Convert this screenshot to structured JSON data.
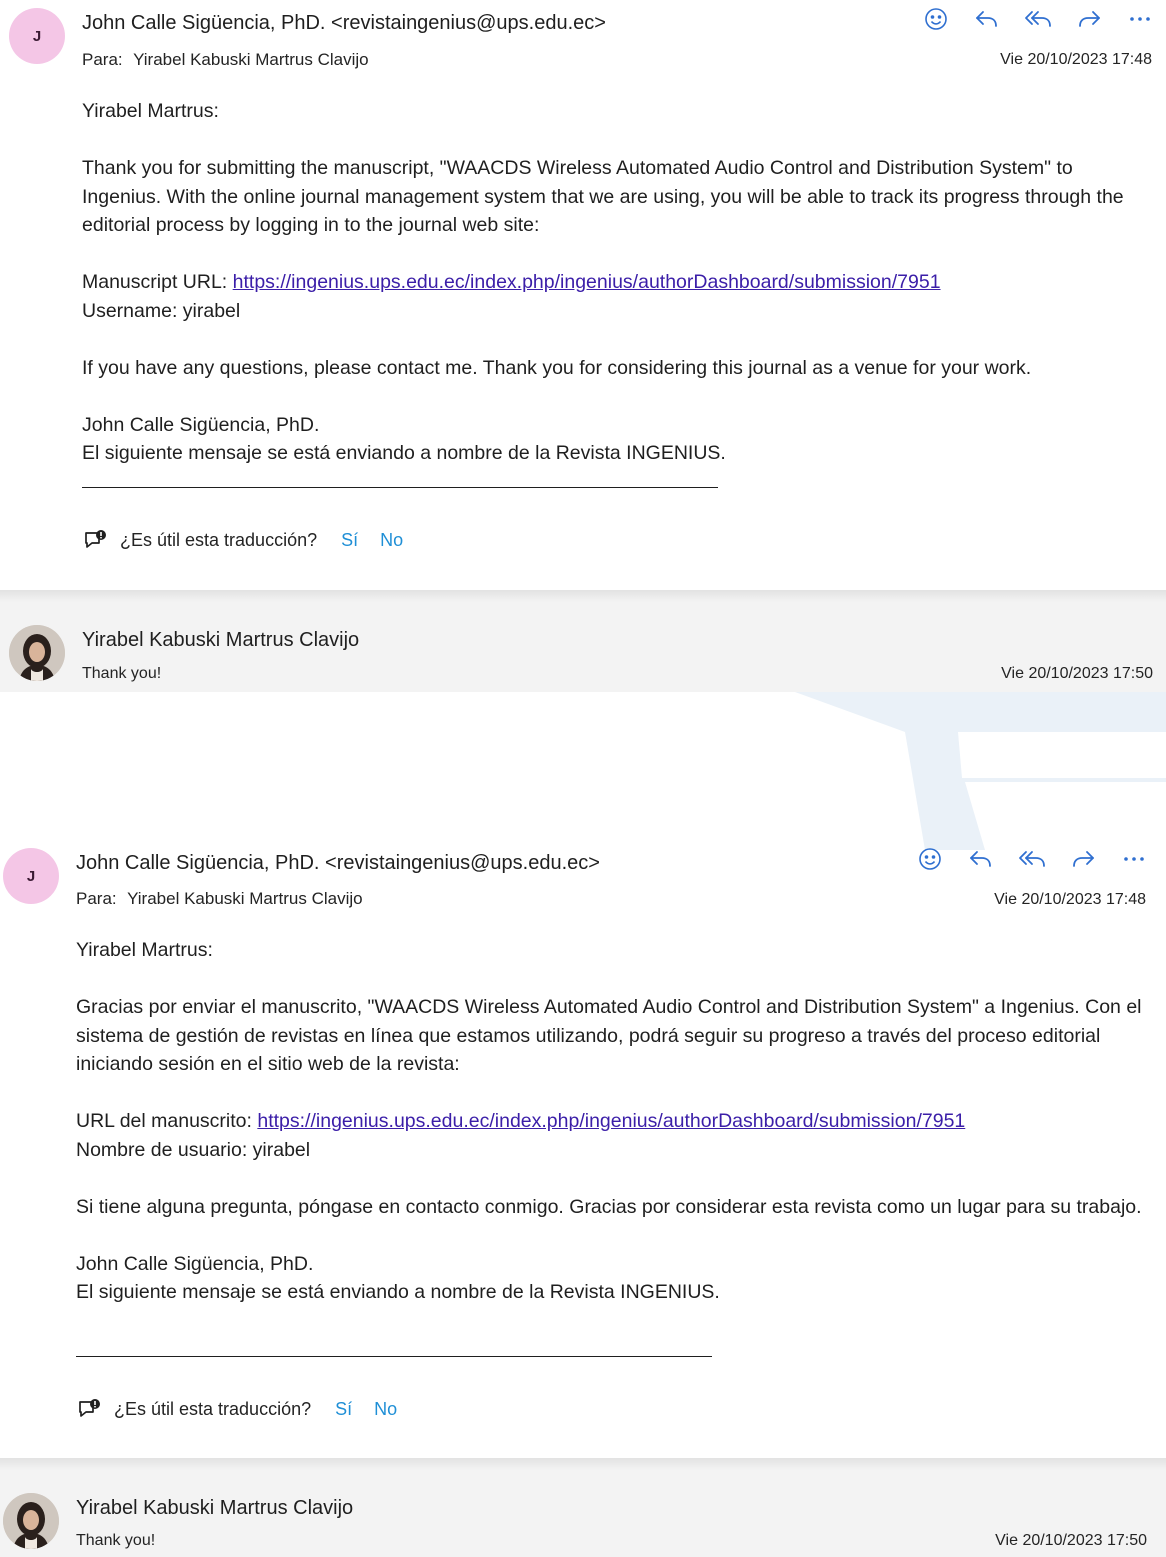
{
  "email1": {
    "avatar_letter": "J",
    "sender": "John Calle Sigüencia, PhD. <revistaingenius@ups.edu.ec>",
    "to_label": "Para:",
    "to": "Yirabel Kabuski Martrus Clavijo",
    "date": "Vie 20/10/2023 17:48",
    "actions": [
      "smiley-icon",
      "reply-icon",
      "reply-all-icon",
      "forward-icon",
      "more-icon"
    ],
    "greeting": "Yirabel Martrus:",
    "paragraph1": "Thank you for submitting the manuscript, \"WAACDS Wireless Automated Audio Control and Distribution System\" to Ingenius. With the online journal management system that we are using, you will be able to track its progress through the editorial process by logging in to the journal web site:",
    "url_label": "Manuscript URL:",
    "url": "https://ingenius.ups.edu.ec/index.php/ingenius/authorDashboard/submission/7951",
    "username_line": "Username: yirabel",
    "paragraph2": "If you have any questions, please contact me. Thank you for considering this journal as a venue for your work.",
    "signature_name": "John Calle Sigüencia, PhD.",
    "signature_note": "El siguiente mensaje se está enviando a nombre de la Revista INGENIUS.",
    "feedback_question": "¿Es útil esta traducción?",
    "feedback_yes": "Sí",
    "feedback_no": "No"
  },
  "reply1": {
    "name": "Yirabel Kabuski Martrus Clavijo",
    "preview": "Thank you!",
    "date": "Vie 20/10/2023 17:50"
  },
  "email2": {
    "avatar_letter": "J",
    "sender": "John Calle Sigüencia, PhD. <revistaingenius@ups.edu.ec>",
    "to_label": "Para:",
    "to": "Yirabel Kabuski Martrus Clavijo",
    "date": "Vie 20/10/2023 17:48",
    "greeting": "Yirabel Martrus:",
    "paragraph1": "Gracias por enviar el manuscrito, \"WAACDS Wireless Automated Audio Control and Distribution System\" a Ingenius. Con el sistema de gestión de revistas en línea que estamos utilizando, podrá seguir su progreso a través del proceso editorial iniciando sesión en el sitio web de la revista:",
    "url_label": "URL del manuscrito:",
    "url": "https://ingenius.ups.edu.ec/index.php/ingenius/authorDashboard/submission/7951",
    "username_line": "Nombre de usuario: yirabel",
    "paragraph2": "Si tiene alguna pregunta, póngase en contacto conmigo. Gracias por considerar esta revista como un lugar para su trabajo.",
    "signature_name": "John Calle Sigüencia, PhD.",
    "signature_note": "El siguiente mensaje se está enviando a nombre de la Revista INGENIUS.",
    "feedback_question": "¿Es útil esta traducción?",
    "feedback_yes": "Sí",
    "feedback_no": "No"
  },
  "reply2": {
    "name": "Yirabel Kabuski Martrus Clavijo",
    "preview": "Thank you!",
    "date": "Vie 20/10/2023 17:50"
  },
  "colors": {
    "accent": "#2f6fd0",
    "link": "#3b1ea8",
    "feedback_link": "#1f8fd6",
    "avatar_bg": "#f4c6e6"
  }
}
